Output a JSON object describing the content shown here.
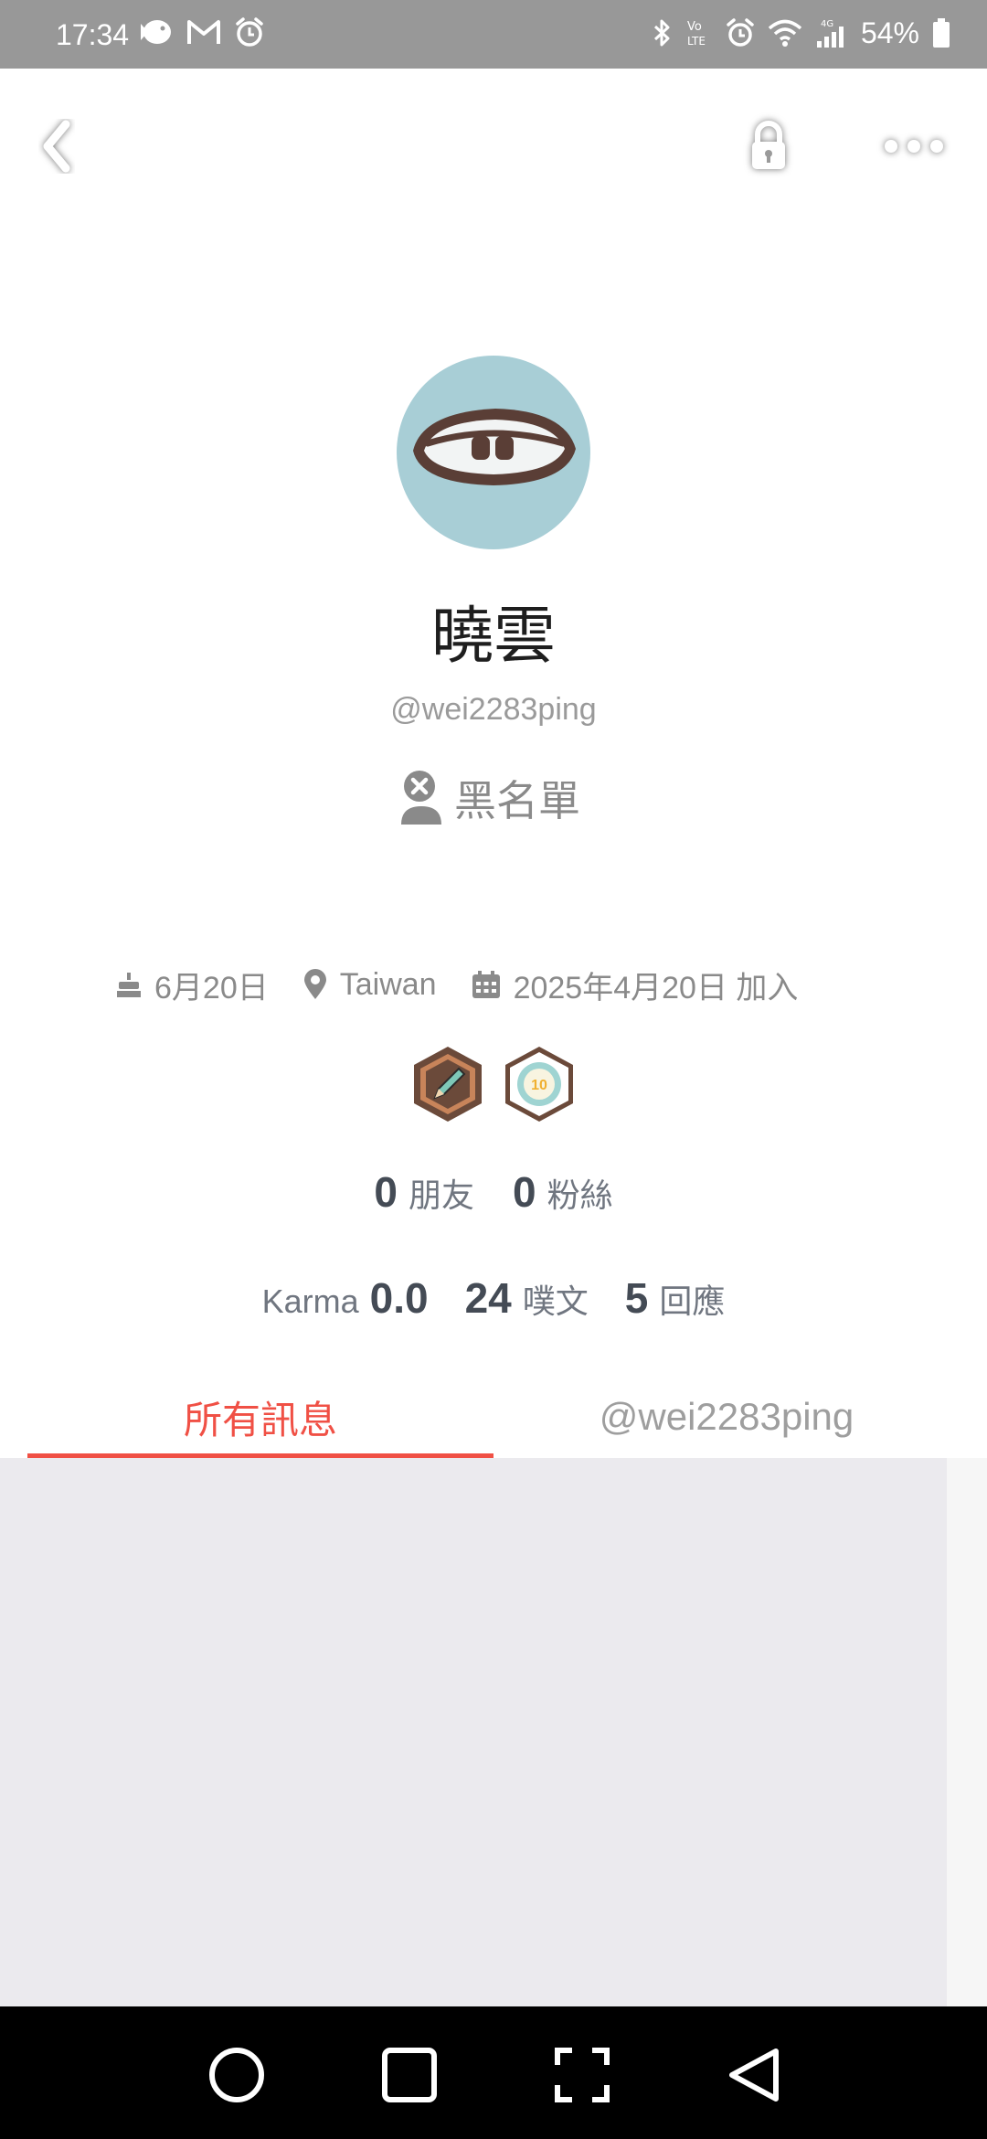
{
  "status_bar": {
    "time": "17:34",
    "battery": "54%",
    "network": "4G",
    "left_icons": [
      "fish-notification-icon",
      "gmail-icon",
      "alarm-snooze-icon"
    ],
    "right_icons": [
      "bluetooth-icon",
      "volte-icon",
      "alarm-icon",
      "wifi-icon",
      "signal-icon",
      "battery-icon"
    ]
  },
  "top_bar": {
    "back_icon": "chevron-left-icon",
    "lock_icon": "lock-icon",
    "more_icon": "more-dots-icon"
  },
  "profile": {
    "display_name": "曉雲",
    "handle": "@wei2283ping",
    "blacklist_label": "黑名單",
    "birthday": "6月20日",
    "location": "Taiwan",
    "joined": "2025年4月20日 加入",
    "badges": [
      "pencil-badge-icon",
      "level-10-badge-icon"
    ],
    "badge_level": "10"
  },
  "stats": {
    "friends": {
      "value": "0",
      "label": "朋友"
    },
    "followers": {
      "value": "0",
      "label": "粉絲"
    },
    "karma": {
      "label": "Karma",
      "value": "0.0"
    },
    "plurks": {
      "value": "24",
      "label": "噗文"
    },
    "replies": {
      "value": "5",
      "label": "回應"
    }
  },
  "tabs": [
    {
      "label": "所有訊息",
      "active": true
    },
    {
      "label": "@wei2283ping",
      "active": false
    }
  ],
  "colors": {
    "accent": "#f05045",
    "status_bar": "#989898",
    "avatar_bg": "#a8ced6",
    "content_bg": "#ebeaee",
    "badge_brown": "#6b4a3a"
  }
}
